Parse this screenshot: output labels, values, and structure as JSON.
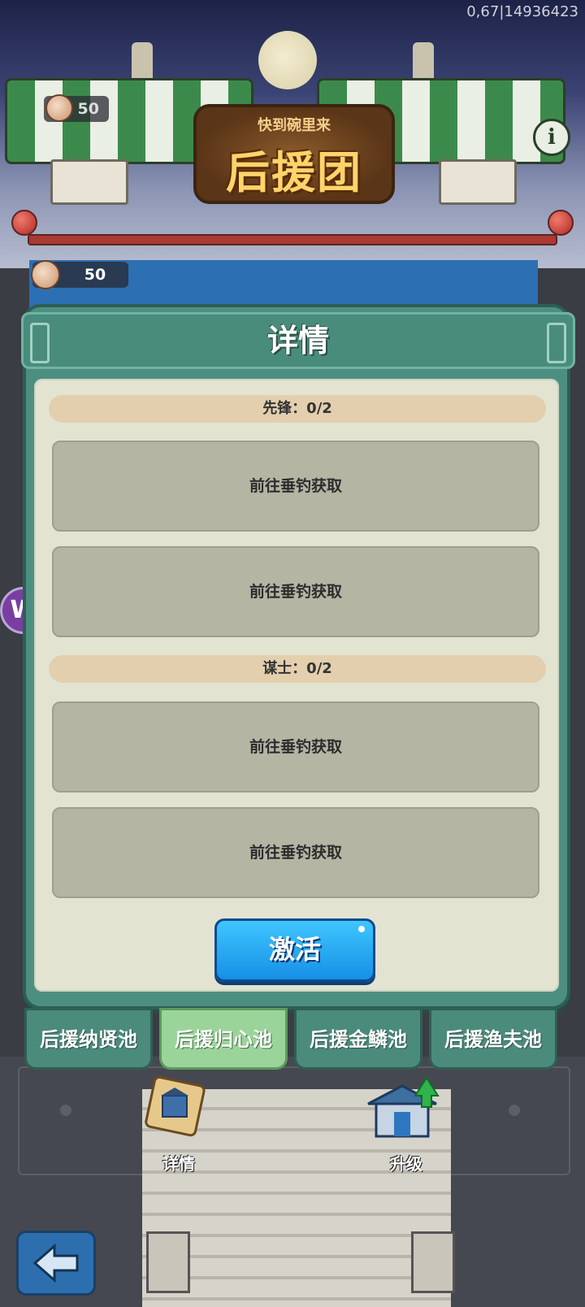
{
  "corner_counter": "0,67|14936423",
  "header": {
    "banner_subtitle": "快到碗里来",
    "banner_title": "后援团",
    "coin_count_top": "50",
    "coin_count": "50"
  },
  "panel": {
    "title": "详情",
    "sections": [
      {
        "label": "先锋：0/2",
        "slots": [
          "前往垂钓获取",
          "前往垂钓获取"
        ]
      },
      {
        "label": "谋士：0/2",
        "slots": [
          "前往垂钓获取",
          "前往垂钓获取"
        ]
      }
    ],
    "activate_label": "激活"
  },
  "tabs": [
    {
      "label": "后援纳贤池",
      "active": false
    },
    {
      "label": "后援归心池",
      "active": true
    },
    {
      "label": "后援金鳞池",
      "active": false
    },
    {
      "label": "后援渔夫池",
      "active": false
    }
  ],
  "bottom_nav": {
    "details_label": "详情",
    "upgrade_label": "升级"
  },
  "colors": {
    "panel_green": "#4c8f80",
    "active_tab": "#9bd49a",
    "activate_blue": "#1ea3f2",
    "slot_gray": "#b4b5a3",
    "section_beige": "#e3cfae"
  },
  "icons": [
    "coin-icon",
    "info-icon",
    "side-app-logo-icon",
    "scroll-icon",
    "temple-upgrade-icon",
    "back-arrow-icon"
  ]
}
